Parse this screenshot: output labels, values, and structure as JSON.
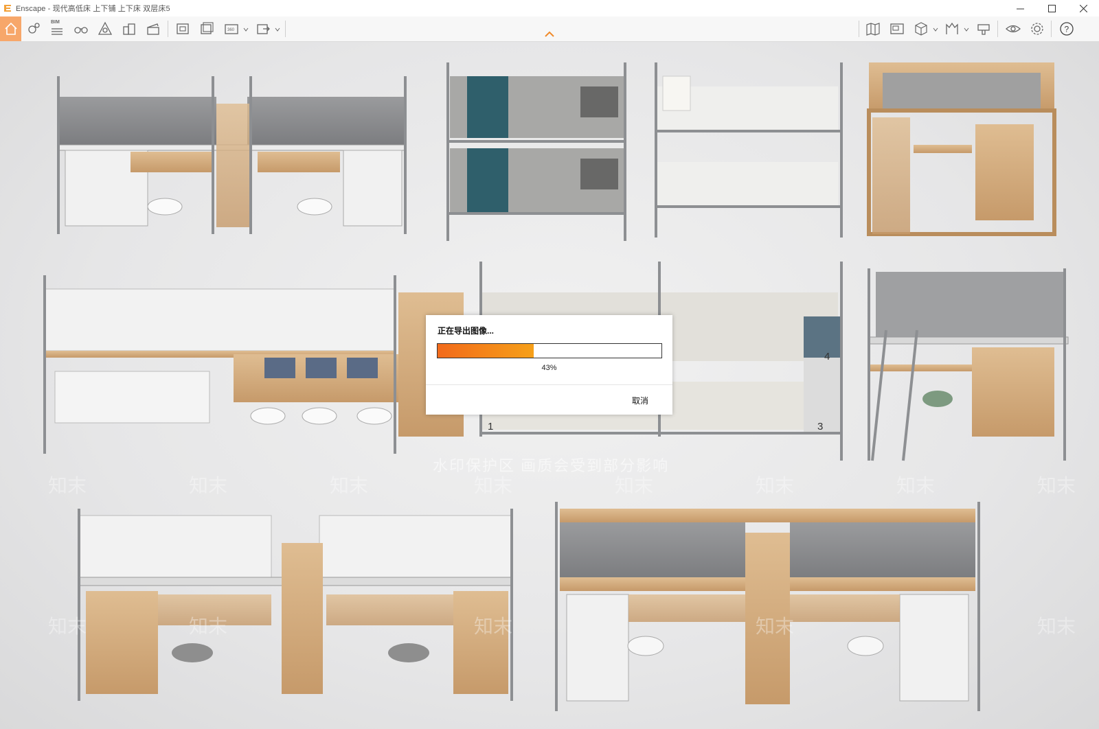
{
  "window": {
    "title": "Enscape - 现代高低床 上下铺 上下床 双层床5",
    "controls": {
      "minimize": "—",
      "maximize": "☐",
      "close": "✕"
    }
  },
  "toolbar": {
    "bim_label": "BIM",
    "left_tools": [
      "home-icon",
      "pin-icon",
      "bim-icon",
      "binoculars-icon",
      "perspective-icon",
      "buildings-icon",
      "clapperboard-icon",
      "screenshot-icon",
      "batch-render-icon",
      "panorama-icon",
      "export-icon"
    ],
    "right_tools": [
      "map-icon",
      "view-manager-icon",
      "cube-icon",
      "asset-library-icon",
      "material-icon",
      "visual-settings-icon",
      "settings-icon",
      "help-icon"
    ],
    "help_label": "?"
  },
  "scene": {
    "watermark": "水印保护区 画质会受到部分影响",
    "watermark_mark": "知末",
    "bed_numbers": [
      "1",
      "3",
      "4"
    ]
  },
  "dialog": {
    "title": "正在导出图像...",
    "progress_percent": 43,
    "progress_label": "43%",
    "cancel_label": "取消"
  },
  "colors": {
    "accent": "#f7a76a",
    "progress_start": "#f26a1b",
    "progress_end": "#f6a019",
    "wood": "#d2aa7e",
    "metal": "#b9bbbe",
    "mattress": "#8e8f91"
  }
}
